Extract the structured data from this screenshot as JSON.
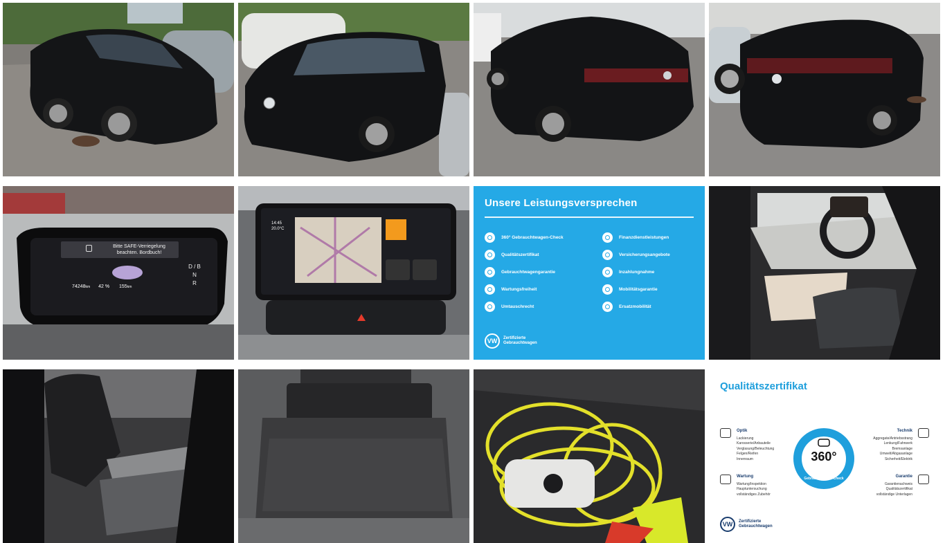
{
  "leistungen_card": {
    "title": "Unsere Leistungsversprechen",
    "items": [
      {
        "label": "360° Gebrauchtwagen-Check",
        "icon": "check-360-icon"
      },
      {
        "label": "Finanzdienstleistungen",
        "icon": "finance-icon"
      },
      {
        "label": "Qualitätszertifikat",
        "icon": "certificate-icon"
      },
      {
        "label": "Versicherungsangebote",
        "icon": "insurance-icon"
      },
      {
        "label": "Gebrauchtwagengarantie",
        "icon": "warranty-icon"
      },
      {
        "label": "Inzahlungnahme",
        "icon": "trade-in-icon"
      },
      {
        "label": "Wartungsfreiheit",
        "icon": "maintenance-icon"
      },
      {
        "label": "Mobilitätsgarantie",
        "icon": "mobility-icon"
      },
      {
        "label": "Umtauschrecht",
        "icon": "exchange-icon"
      },
      {
        "label": "Ersatzmobilität",
        "icon": "replacement-car-icon"
      }
    ],
    "brand_line1": "Zertifizierte",
    "brand_line2": "Gebrauchtwagen",
    "logo_text": "VW"
  },
  "zertifikat_card": {
    "title": "Qualitätszertifikat",
    "badge_number": "360°",
    "badge_ring_text": "Gebrauchtwagen-Check",
    "optik": {
      "heading": "Optik",
      "lines": [
        "Lackierung",
        "Karosserie/Anbauteile",
        "Verglasung/Beleuchtung",
        "Felgen/Reifen",
        "Innenraum"
      ]
    },
    "technik": {
      "heading": "Technik",
      "lines": [
        "Aggregate/Antriebsstrang",
        "Lenkung/Fahrwerk",
        "Bremsanlage",
        "Umwelt/Abgasanlage",
        "Sicherheit/Elektrik"
      ]
    },
    "wartung": {
      "heading": "Wartung",
      "lines": [
        "Wartung/Inspektion",
        "Hauptuntersuchung",
        "vollständiges Zubehör"
      ]
    },
    "garantie": {
      "heading": "Garantie",
      "lines": [
        "Garantienachweis",
        "Qualitätszertifikat",
        "vollständige Unterlagen"
      ]
    },
    "brand_line1": "Zertifizierte",
    "brand_line2": "Gebrauchtwagen",
    "logo_text": "VW"
  },
  "cluster_screen": {
    "line1": "Bitte SAFE-Verriegelung",
    "line2": "beachten. Bordbuch!",
    "odometer": "74248",
    "odometer_unit": "km",
    "battery": "42 %",
    "range": "155",
    "range_unit": "km",
    "gear_d": "D",
    "gear_b": "B",
    "gear_n": "N",
    "gear_r": "R"
  },
  "infotainment_screen": {
    "time": "14:45",
    "temp": "20.0°C"
  },
  "colors": {
    "card_blue": "#25a9e6",
    "title_blue": "#1f9fdc",
    "car_black": "#111214"
  }
}
